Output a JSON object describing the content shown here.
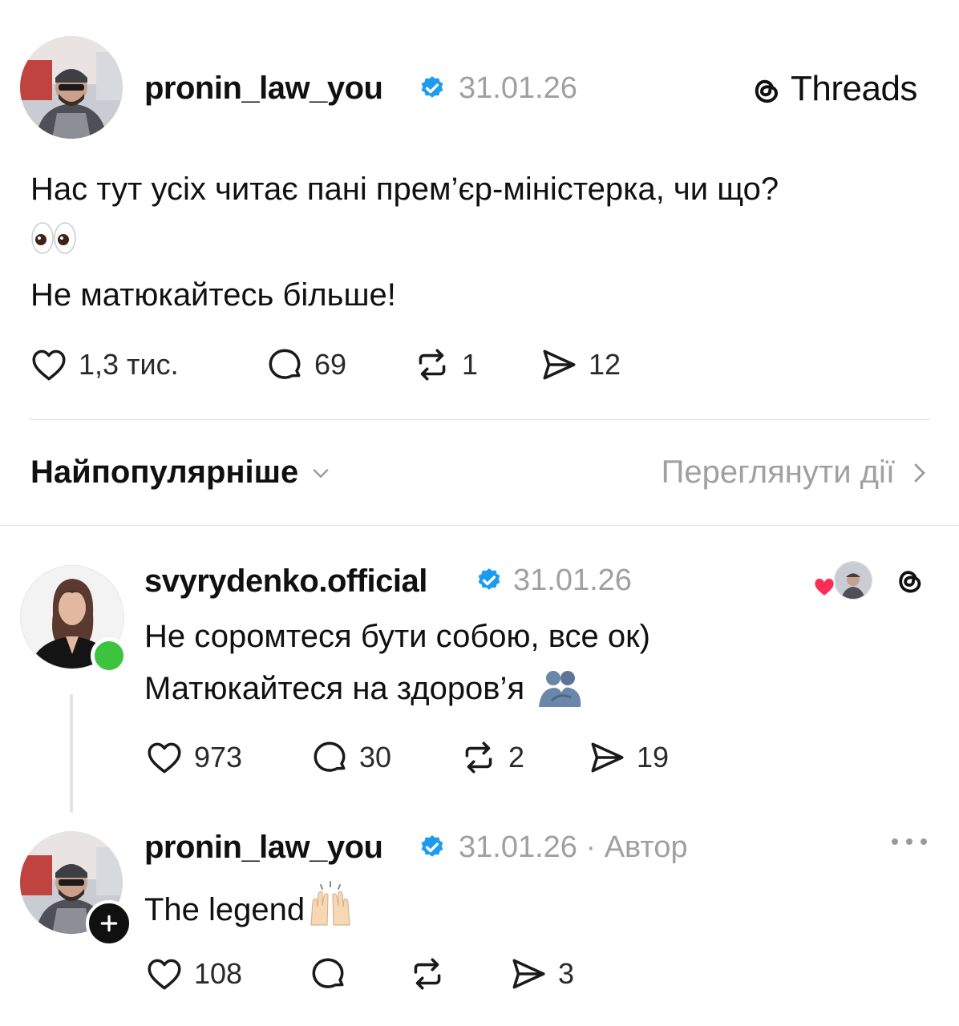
{
  "header": {
    "brand": "Threads"
  },
  "post": {
    "username": "pronin_law_you",
    "date": "31.01.26",
    "line1": "Нас тут усіх читає пані прем’єр-міністерка, чи що?",
    "line2": "Не матюкайтесь більше!",
    "likes": "1,3 тис.",
    "comments": "69",
    "reposts": "1",
    "shares": "12"
  },
  "sort": {
    "label": "Найпопулярніше",
    "view_activity": "Переглянути дії"
  },
  "reply1": {
    "username": "svyrydenko.official",
    "date": "31.01.26",
    "line1": "Не соромтеся бути собою, все ок)",
    "line2": "Матюкайтеся на здоров’я",
    "likes": "973",
    "comments": "30",
    "reposts": "2",
    "shares": "19"
  },
  "reply2": {
    "username": "pronin_law_you",
    "date": "31.01.26",
    "author_tag": "· Автор",
    "text": "The legend",
    "likes": "108",
    "shares": "3"
  },
  "colors": {
    "verified": "#1d9bf0",
    "online": "#3ec33e",
    "heart": "#ff2d55"
  }
}
